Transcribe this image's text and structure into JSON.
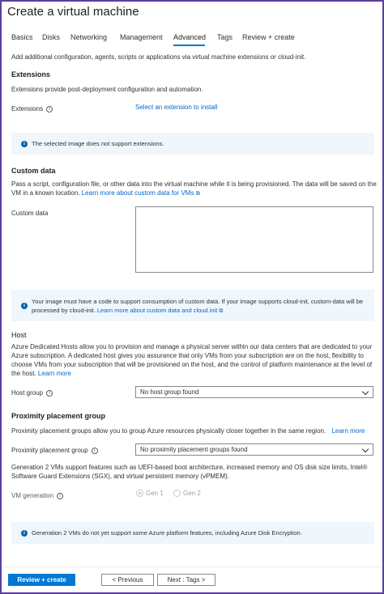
{
  "page": {
    "title": "Create a virtual machine"
  },
  "tabs": [
    {
      "label": "Basics"
    },
    {
      "label": "Disks"
    },
    {
      "label": "Networking"
    },
    {
      "label": "Management"
    },
    {
      "label": "Advanced"
    },
    {
      "label": "Tags"
    },
    {
      "label": "Review + create"
    }
  ],
  "intro": "Add additional configuration, agents, scripts or applications via virtual machine extensions or cloud-init.",
  "extensions": {
    "heading": "Extensions",
    "description": "Extensions provide post-deployment configuration and automation.",
    "field_label": "Extensions",
    "select_link": "Select an extension to install",
    "info": "The selected image does not support extensions."
  },
  "custom_data": {
    "heading": "Custom data",
    "description": "Pass a script, configuration file, or other data into the virtual machine while it is being provisioned. The data will be saved on the VM in a known location.",
    "learn_more": "Learn more about custom data for VMs",
    "field_label": "Custom data",
    "value": "",
    "info": "Your image must have a code to support consumption of custom data. If your image supports cloud-init, custom-data will be processed by cloud-init.",
    "info_link": "Learn more about custom data and cloud init"
  },
  "host": {
    "heading": "Host",
    "description": "Azure Dedicated Hosts allow you to provision and manage a physical server within our data centers that are dedicated to your Azure subscription. A dedicated host gives you assurance that only VMs from your subscription are on the host, flexibility to choose VMs from your subscription that will be provisioned on the host, and the control of platform maintenance at the level of the host.",
    "learn_more": "Learn more",
    "field_label": "Host group",
    "selected": "No host group found"
  },
  "proximity": {
    "heading": "Proximity placement group",
    "description": "Proximity placement groups allow you to group Azure resources physically closer together in the same region.",
    "learn_more": "Learn more",
    "field_label": "Proximity placement group",
    "selected": "No proximity placement groups found"
  },
  "generation": {
    "description": "Generation 2 VMs support features such as UEFI-based boot architecture, increased memory and OS disk size limits, Intel® Software Guard Extensions (SGX), and virtual persistent memory (vPMEM).",
    "field_label": "VM generation",
    "options": [
      {
        "label": "Gen 1",
        "checked": true
      },
      {
        "label": "Gen 2",
        "checked": false
      }
    ],
    "info": "Generation 2 VMs do not yet support some Azure platform features, including Azure Disk Encryption."
  },
  "footer": {
    "review_create": "Review + create",
    "previous": "< Previous",
    "next": "Next : Tags >"
  },
  "colors": {
    "accent": "#0078d4",
    "info_bg": "#eff6fc",
    "frame": "#5b3f9e",
    "link": "#0066cc"
  }
}
